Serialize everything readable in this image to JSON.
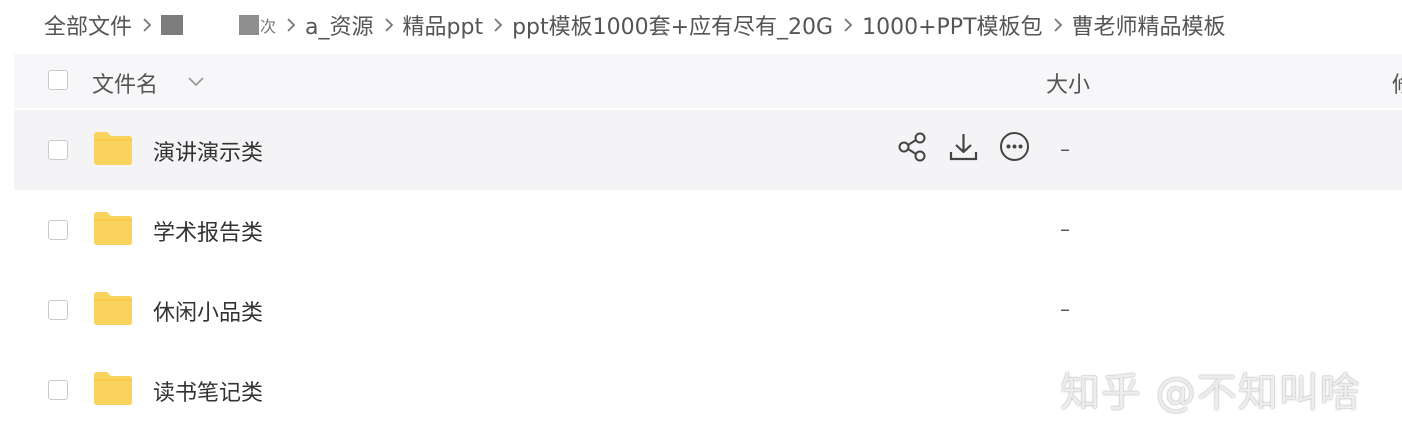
{
  "breadcrumb": {
    "items": [
      {
        "label": "全部文件"
      },
      {
        "label": "a_资源"
      },
      {
        "label": "精品ppt"
      },
      {
        "label": "ppt模板1000套+应有尽有_20G"
      },
      {
        "label": "1000+PPT模板包"
      },
      {
        "label": "曹老师精品模板"
      }
    ],
    "redacted_tail": "次"
  },
  "header": {
    "name_label": "文件名",
    "size_label": "大小",
    "next_label_cut": "修"
  },
  "rows": [
    {
      "name": "演讲演示类",
      "size": "–",
      "hover": true
    },
    {
      "name": "学术报告类",
      "size": "–"
    },
    {
      "name": "休闲小品类",
      "size": "–"
    },
    {
      "name": "读书笔记类",
      "size": ""
    }
  ],
  "watermark": "知乎 @不知叫啥",
  "colors": {
    "folder": "#FAD35E",
    "folder_tab": "#F5C342",
    "header_bg": "#f7f7f9",
    "hover_bg": "#f4f4f6"
  }
}
